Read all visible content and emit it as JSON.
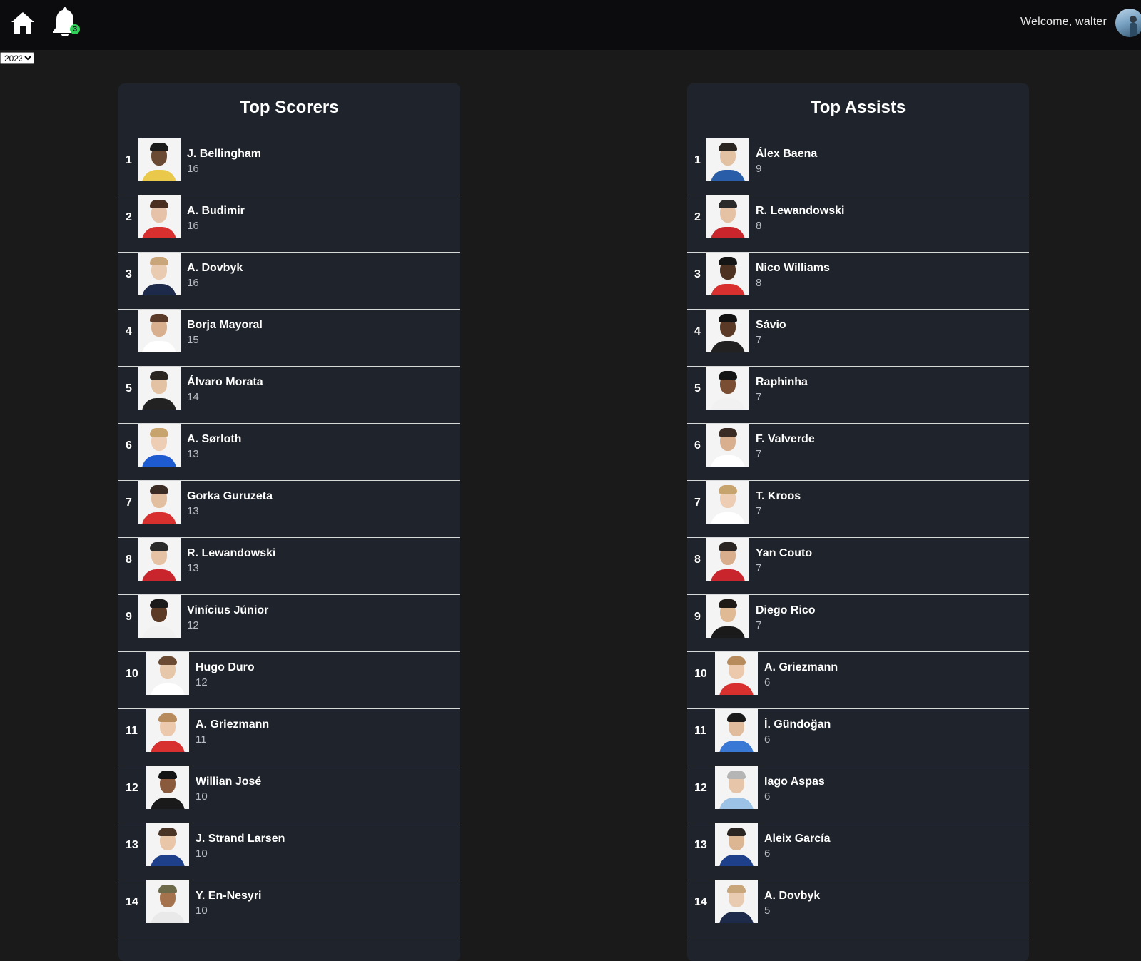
{
  "header": {
    "welcome_text": "Welcome, walter",
    "notification_count": "3",
    "home_icon": "home-icon",
    "bell_icon": "bell-icon"
  },
  "season_select": {
    "selected": "2023"
  },
  "top_scorers": {
    "title": "Top Scorers",
    "rows": [
      {
        "rank": "1",
        "name": "J. Bellingham",
        "value": "16"
      },
      {
        "rank": "2",
        "name": "A. Budimir",
        "value": "16"
      },
      {
        "rank": "3",
        "name": "A. Dovbyk",
        "value": "16"
      },
      {
        "rank": "4",
        "name": "Borja Mayoral",
        "value": "15"
      },
      {
        "rank": "5",
        "name": "Álvaro Morata",
        "value": "14"
      },
      {
        "rank": "6",
        "name": "A. Sørloth",
        "value": "13"
      },
      {
        "rank": "7",
        "name": "Gorka Guruzeta",
        "value": "13"
      },
      {
        "rank": "8",
        "name": "R. Lewandowski",
        "value": "13"
      },
      {
        "rank": "9",
        "name": "Vinícius Júnior",
        "value": "12"
      },
      {
        "rank": "10",
        "name": "Hugo Duro",
        "value": "12"
      },
      {
        "rank": "11",
        "name": "A. Griezmann",
        "value": "11"
      },
      {
        "rank": "12",
        "name": "Willian José",
        "value": "10"
      },
      {
        "rank": "13",
        "name": "J. Strand Larsen",
        "value": "10"
      },
      {
        "rank": "14",
        "name": "Y. En-Nesyri",
        "value": "10"
      }
    ]
  },
  "top_assists": {
    "title": "Top Assists",
    "rows": [
      {
        "rank": "1",
        "name": "Álex Baena",
        "value": "9"
      },
      {
        "rank": "2",
        "name": "R. Lewandowski",
        "value": "8"
      },
      {
        "rank": "3",
        "name": "Nico Williams",
        "value": "8"
      },
      {
        "rank": "4",
        "name": "Sávio",
        "value": "7"
      },
      {
        "rank": "5",
        "name": "Raphinha",
        "value": "7"
      },
      {
        "rank": "6",
        "name": "F. Valverde",
        "value": "7"
      },
      {
        "rank": "7",
        "name": "T. Kroos",
        "value": "7"
      },
      {
        "rank": "8",
        "name": "Yan Couto",
        "value": "7"
      },
      {
        "rank": "9",
        "name": "Diego Rico",
        "value": "7"
      },
      {
        "rank": "10",
        "name": "A. Griezmann",
        "value": "6"
      },
      {
        "rank": "11",
        "name": "İ. Gündoğan",
        "value": "6"
      },
      {
        "rank": "12",
        "name": "Iago Aspas",
        "value": "6"
      },
      {
        "rank": "13",
        "name": "Aleix García",
        "value": "6"
      },
      {
        "rank": "14",
        "name": "A. Dovbyk",
        "value": "5"
      }
    ]
  },
  "colors": {
    "page_bg": "#1a1a1a",
    "topbar_bg": "#0c0c0e",
    "panel_bg": "#1f232b",
    "badge": "#30d158",
    "value_text": "#b9bcc2"
  }
}
